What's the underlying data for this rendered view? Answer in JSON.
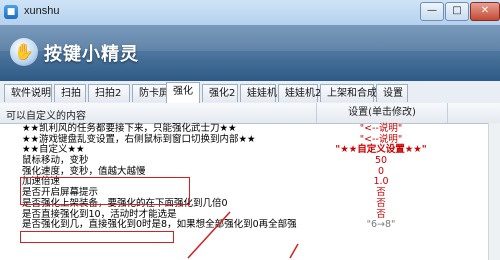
{
  "window": {
    "title": "xunshu",
    "min": "—",
    "max": "□",
    "close": "✕"
  },
  "brand": {
    "title": "按键小精灵"
  },
  "tabs": [
    "软件说明",
    "扫拍",
    "扫拍2",
    "防卡屏",
    "强化",
    "强化2",
    "娃娃机",
    "娃娃机2",
    "上架和合成",
    "设置"
  ],
  "table": {
    "header_left": "可以自定义的内容",
    "header_right": "设置(单击修改)",
    "rows": [
      {
        "k": "★★凯利风的任务都要接下来，只能强化武士刀★★",
        "v": "\"<--说明\""
      },
      {
        "k": "★★游戏键盘乱变设置，右侧鼠标到窗口切换到内部★★",
        "v": "\"<--说明\""
      },
      {
        "k": "★★自定义★★",
        "v": "\"★★自定义设置★★\""
      },
      {
        "k": "鼠标移动，变秒",
        "v": "50"
      },
      {
        "k": "强化速度，变秒，值越大越慢",
        "v": "0"
      },
      {
        "k": "加速倍速",
        "v": "1.0"
      },
      {
        "k": "是否开启屏幕提示",
        "v": "否"
      },
      {
        "k": "是否强化上架装备，要强化的在下面强化到几倍0",
        "v": "否"
      },
      {
        "k": "是否直接强化到10，活动时才能选是",
        "v": "否"
      },
      {
        "k": "是否强化到几，直接强化到0时是8，如果想全部强化到0再全部强",
        "v": "\"6→8\""
      }
    ]
  },
  "colors": {
    "annotation": "#d32020",
    "value_red": "#cc0000",
    "banner": "#2e5a85"
  },
  "icons": {
    "app": "app-icon",
    "brand": "brand-logo-icon"
  }
}
